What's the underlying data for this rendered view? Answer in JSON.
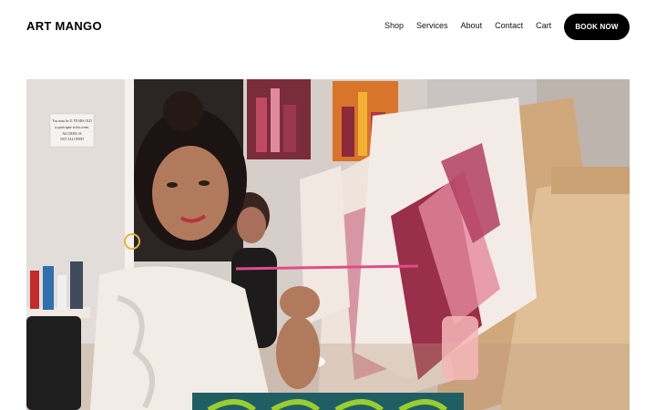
{
  "header": {
    "logo": "ART MANGO",
    "nav": [
      {
        "label": "Shop"
      },
      {
        "label": "Services"
      },
      {
        "label": "About"
      },
      {
        "label": "Contact"
      },
      {
        "label": "Cart"
      }
    ],
    "cta_label": "BOOK NOW"
  },
  "hero": {
    "wall_sign_lines": [
      "You must be 21 YEARS OLD",
      "to participate in this event.",
      "ALCOHOL IS",
      "NOT ALLOWED"
    ],
    "colors": {
      "wall": "#d9d2cc",
      "canvas": "#f1ece6",
      "easel": "#d4b08a",
      "banner": "#1f5e63"
    }
  }
}
